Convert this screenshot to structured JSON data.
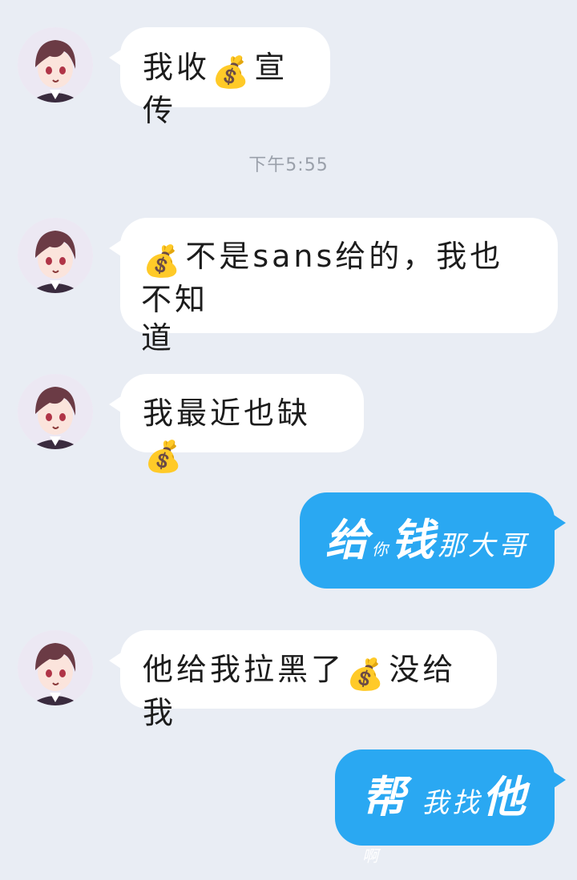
{
  "timestamp": "下午5:55",
  "messages": [
    {
      "side": "in",
      "parts": [
        "我收",
        "💰",
        "宣传"
      ]
    },
    {
      "side": "in",
      "parts": [
        "💰",
        "不是sans给的，我也不知",
        "道"
      ]
    },
    {
      "side": "in",
      "parts": [
        "我最近也缺",
        "💰"
      ]
    },
    {
      "side": "out",
      "parts": [
        "给",
        "你",
        "钱",
        "那大哥"
      ]
    },
    {
      "side": "in",
      "parts": [
        "他给我拉黑了",
        "💰",
        "没给我"
      ]
    },
    {
      "side": "out",
      "parts": [
        "帮",
        "我找",
        "他",
        "啊"
      ]
    }
  ],
  "colors": {
    "background": "#e9edf4",
    "incoming_bubble": "#ffffff",
    "outgoing_bubble": "#2aa8f2",
    "timestamp": "#9aa0aa"
  },
  "icons": {
    "avatar": "anime-avatar-icon",
    "money": "money-bag-icon"
  }
}
